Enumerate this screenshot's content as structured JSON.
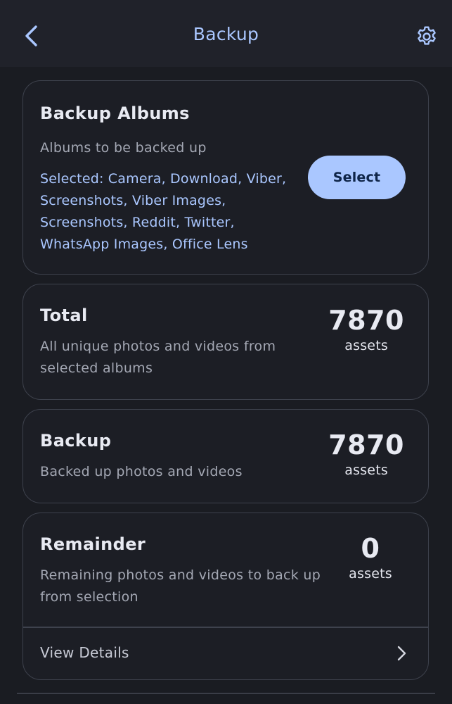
{
  "header": {
    "title": "Backup",
    "back_icon": "arrow-back-icon",
    "settings_icon": "gear-icon",
    "accent_color": "#aac7ff"
  },
  "albums_card": {
    "title": "Backup Albums",
    "subtitle": "Albums to be backed up",
    "selected_text": "Selected: Camera, Download, Viber, Screenshots, Viber Images, Screenshots, Reddit, Twitter, WhatsApp Images, Office Lens",
    "select_label": "Select"
  },
  "total_card": {
    "title": "Total",
    "subtitle": "All unique photos and videos from selected albums",
    "count": "7870",
    "unit": "assets"
  },
  "backup_card": {
    "title": "Backup",
    "subtitle": "Backed up photos and videos",
    "count": "7870",
    "unit": "assets"
  },
  "remainder_card": {
    "title": "Remainder",
    "subtitle": "Remaining photos and videos to back up from selection",
    "count": "0",
    "unit": "assets",
    "details_label": "View Details",
    "details_icon": "chevron-right-icon"
  }
}
